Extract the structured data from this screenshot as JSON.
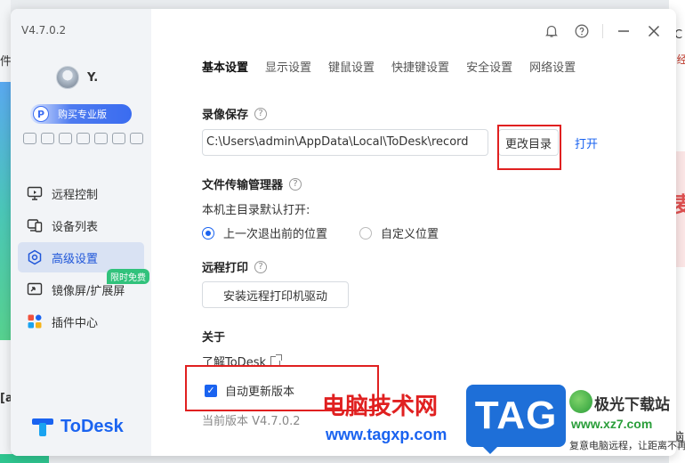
{
  "background": {
    "left_text_top": "件",
    "left_text_bottom": "[a",
    "right_text_top": "C",
    "right_text_red": "(经",
    "right_promo": "麦",
    "right_text_bottom": "脑"
  },
  "app": {
    "version": "V4.7.0.2",
    "username": "Y.",
    "pro_icon": "P",
    "pro_label": "购买专业版",
    "logo_text": "ToDesk"
  },
  "sidebar": {
    "items": [
      {
        "label": "远程控制",
        "icon": "remote-control-icon"
      },
      {
        "label": "设备列表",
        "icon": "device-list-icon"
      },
      {
        "label": "高级设置",
        "icon": "advanced-settings-icon",
        "active": true
      },
      {
        "label": "镜像屏/扩展屏",
        "icon": "mirror-screen-icon",
        "badge": "限时免费"
      },
      {
        "label": "插件中心",
        "icon": "plugin-center-icon"
      }
    ]
  },
  "tabs": [
    {
      "label": "基本设置",
      "active": true
    },
    {
      "label": "显示设置"
    },
    {
      "label": "键鼠设置"
    },
    {
      "label": "快捷键设置"
    },
    {
      "label": "安全设置"
    },
    {
      "label": "网络设置"
    }
  ],
  "recording": {
    "title": "录像保存",
    "help": "?",
    "path": "C:\\Users\\admin\\AppData\\Local\\ToDesk\\record",
    "change_label": "更改目录",
    "open_label": "打开"
  },
  "file_transfer": {
    "title": "文件传输管理器",
    "help": "?",
    "sub_label": "本机主目录默认打开:",
    "option_last": "上一次退出前的位置",
    "option_custom": "自定义位置"
  },
  "remote_print": {
    "title": "远程打印",
    "help": "?",
    "install_label": "安装远程打印机驱动"
  },
  "about": {
    "title": "关于",
    "learn_label": "了解ToDesk",
    "auto_update_label": "自动更新版本",
    "check": "✓",
    "current_version": "当前版本 V4.7.0.2"
  },
  "watermark": {
    "cn_text": "电脑技术网",
    "url": "www.tagxp.com",
    "tag": "TAG",
    "site_name": "极光下载站",
    "site_url": "www.xz7.com",
    "site_under": "复意电脑远程，让距离不再是门"
  },
  "colors": {
    "accent": "#1a63f0",
    "highlight_box": "#e02020",
    "free_badge": "#31c27c"
  }
}
